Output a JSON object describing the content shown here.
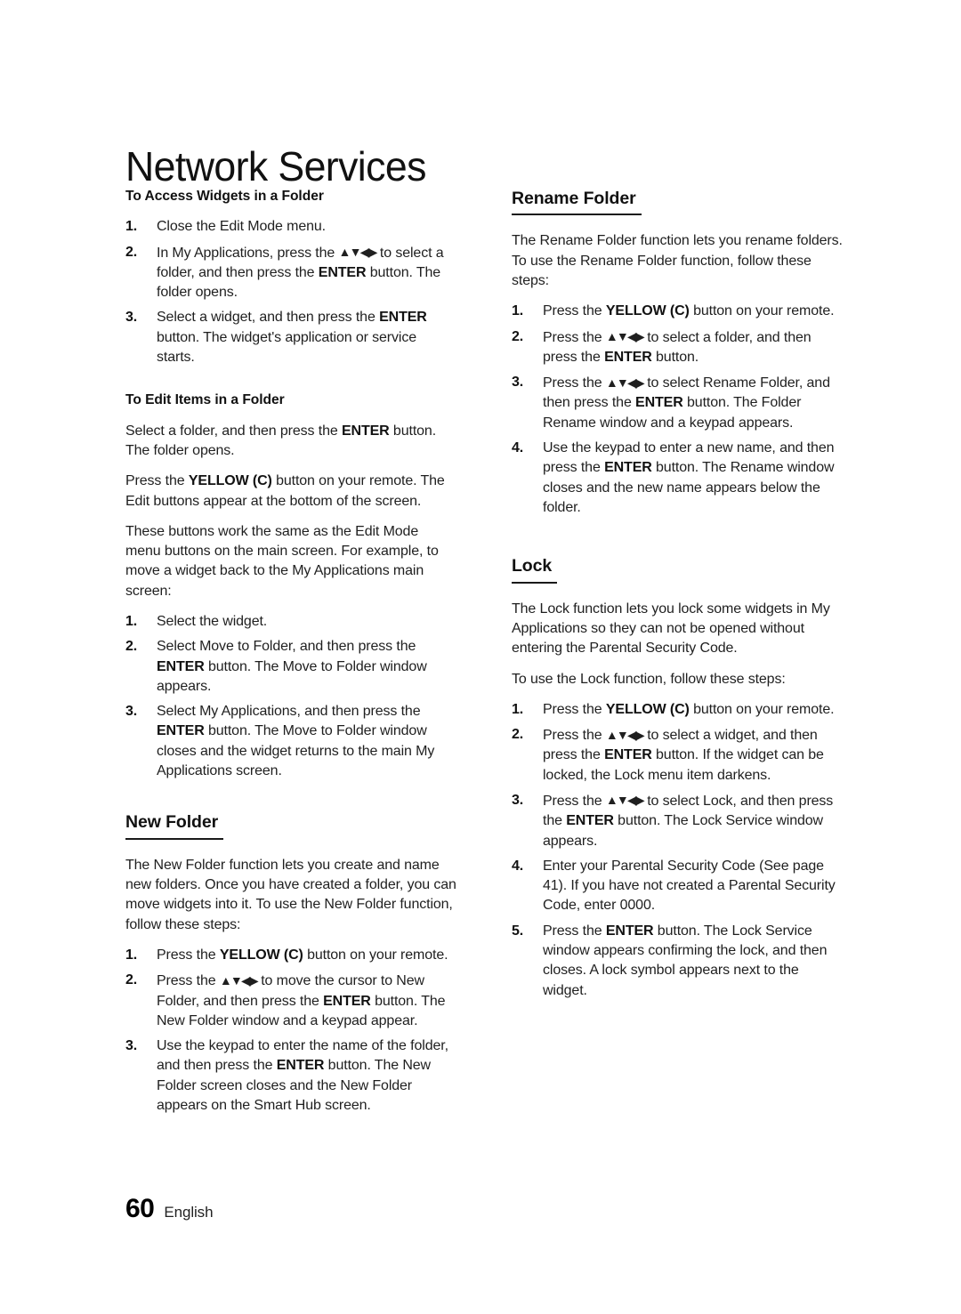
{
  "document": {
    "chapter_title": "Network Services",
    "footer": {
      "page_number": "60",
      "language": "English"
    }
  },
  "arrows_glyph": "▲▼◀▶",
  "left_column": {
    "subhead_access": "To Access Widgets in a Folder",
    "access_steps": [
      {
        "num": "1.",
        "text": "Close the Edit Mode menu."
      },
      {
        "num": "2.",
        "text": "In My Applications, press the ▲▼◀▶ to select a folder, and then press the ENTER button. The folder opens."
      },
      {
        "num": "3.",
        "text": "Select a widget, and then press the ENTER button. The widget's application or service starts."
      }
    ],
    "subhead_edit": "To Edit Items in a Folder",
    "edit_para_1": "Select a folder, and then press the ENTER button. The folder opens.",
    "edit_para_2": "Press the YELLOW (C) button on your remote. The Edit buttons appear at the bottom of the screen.",
    "edit_para_3": "These buttons work the same as the Edit Mode menu buttons on the main screen. For example, to move a widget back to the My Applications main screen:",
    "edit_steps": [
      {
        "num": "1.",
        "text": "Select the widget."
      },
      {
        "num": "2.",
        "text": "Select Move to Folder, and then press the ENTER button. The Move to Folder window appears."
      },
      {
        "num": "3.",
        "text": "Select My Applications, and then press the ENTER button. The Move to Folder window closes and the widget returns to the main My Applications screen."
      }
    ],
    "new_folder_heading": "New Folder",
    "new_folder_intro": "The New Folder function lets you create and name new folders. Once you have created a folder, you can move widgets into it. To use the New Folder function, follow these steps:",
    "new_folder_steps": [
      {
        "num": "1.",
        "text": "Press the YELLOW (C) button on your remote."
      },
      {
        "num": "2.",
        "text": "Press the ▲▼◀▶ to move the cursor to New Folder, and then press the ENTER button. The New Folder window and a keypad appear."
      },
      {
        "num": "3.",
        "text": "Use the keypad to enter the name of the folder, and then press the ENTER button. The New Folder screen closes and the New Folder appears on the Smart Hub screen."
      }
    ]
  },
  "right_column": {
    "rename_folder_heading": "Rename Folder",
    "rename_folder_intro": "The Rename Folder function lets you rename folders. To use the Rename Folder function, follow these steps:",
    "rename_folder_steps": [
      {
        "num": "1.",
        "text": "Press the YELLOW (C) button on your remote."
      },
      {
        "num": "2.",
        "text": "Press the ▲▼◀▶ to select a folder, and then press the ENTER button."
      },
      {
        "num": "3.",
        "text": "Press the ▲▼◀▶ to select Rename Folder, and then press the ENTER button. The Folder Rename window and a keypad appears."
      },
      {
        "num": "4.",
        "text": "Use the keypad to enter a new name, and then press the ENTER button. The Rename window closes and the new name appears below the folder."
      }
    ],
    "lock_heading": "Lock",
    "lock_intro_1": "The Lock function lets you lock some widgets in My Applications so they can not be opened without entering the Parental Security Code.",
    "lock_intro_2": "To use the Lock function, follow these steps:",
    "lock_steps": [
      {
        "num": "1.",
        "text": "Press the YELLOW (C) button on your remote."
      },
      {
        "num": "2.",
        "text": "Press the ▲▼◀▶ to select a widget, and then press the ENTER button. If the widget can be locked, the Lock menu item darkens."
      },
      {
        "num": "3.",
        "text": "Press the ▲▼◀▶ to select Lock, and then press the ENTER button. The Lock Service window appears."
      },
      {
        "num": "4.",
        "text": "Enter your Parental Security Code (See page 41). If you have not created a Parental Security Code, enter 0000."
      },
      {
        "num": "5.",
        "text": "Press the ENTER button. The Lock Service window appears confirming the lock, and then closes. A lock symbol appears next to the widget."
      }
    ]
  }
}
